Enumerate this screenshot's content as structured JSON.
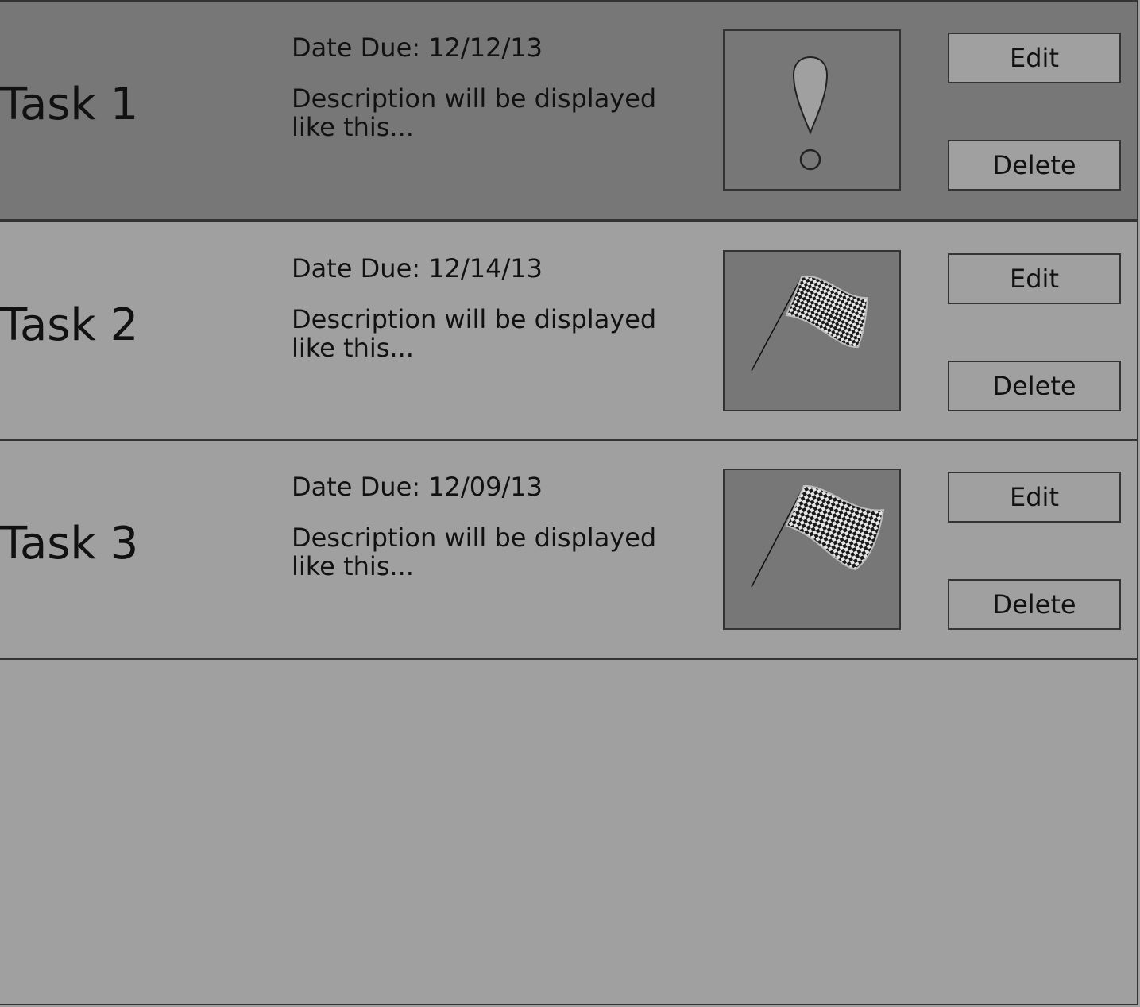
{
  "colors": {
    "selected_row": "#777777",
    "row": "#a0a0a0",
    "border": "#333333"
  },
  "tasks": [
    {
      "title": "Task 1",
      "due": "Date Due: 12/12/13",
      "description": "Description will be displayed like this...",
      "icon": "exclamation-icon",
      "edit_label": "Edit",
      "delete_label": "Delete",
      "selected": true
    },
    {
      "title": "Task 2",
      "due": "Date Due: 12/14/13",
      "description": "Description will be displayed like this...",
      "icon": "checkered-flag-icon",
      "edit_label": "Edit",
      "delete_label": "Delete",
      "selected": false
    },
    {
      "title": "Task 3",
      "due": "Date Due: 12/09/13",
      "description": "Description will be displayed like this...",
      "icon": "checkered-flag-icon",
      "edit_label": "Edit",
      "delete_label": "Delete",
      "selected": false
    }
  ]
}
